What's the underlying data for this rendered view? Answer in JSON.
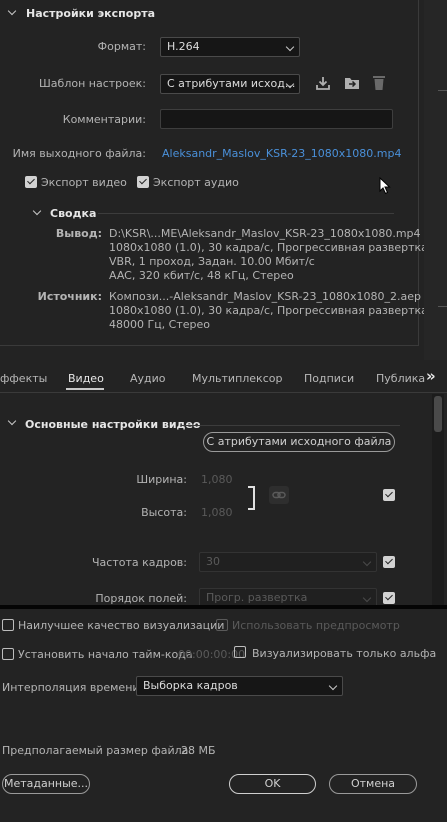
{
  "export_settings": {
    "title": "Настройки экспорта",
    "format_label": "Формат:",
    "format_value": "H.264",
    "preset_label": "Шаблон настроек:",
    "preset_value": "С атрибутами исход...",
    "comments_label": "Комментарии:",
    "comments_value": "",
    "output_name_label": "Имя выходного файла:",
    "output_name_value": "Aleksandr_Maslov_KSR-23_1080x1080.mp4",
    "export_video_label": "Экспорт видео",
    "export_video_checked": true,
    "export_audio_label": "Экспорт аудио",
    "export_audio_checked": true
  },
  "summary": {
    "title": "Сводка",
    "output_label": "Вывод:",
    "output_lines": [
      "D:\\KSR\\...ME\\Aleksandr_Maslov_KSR-23_1080x1080.mp4",
      "1080x1080 (1.0), 30 кадра/с, Прогрессивная развертка...",
      "VBR, 1 проход, Задан. 10.00 Мбит/с",
      "AAC, 320 кбит/с, 48 кГц, Стерео"
    ],
    "source_label": "Источник:",
    "source_lines": [
      "Компози...-Aleksandr_Maslov_KSR-23_1080x1080_2.aep",
      "1080x1080 (1.0), 30 кадра/с, Прогрессивная развертка...",
      "48000 Гц, Стерео"
    ]
  },
  "tabs": {
    "items": [
      "ффекты",
      "Видео",
      "Аудио",
      "Мультиплексор",
      "Подписи",
      "Публика"
    ],
    "active": "Видео",
    "more": "»"
  },
  "video": {
    "section_title": "Основные настройки видео",
    "match_source_button": "С атрибутами исходного файла",
    "width_label": "Ширина:",
    "width_value": "1,080",
    "height_label": "Высота:",
    "height_value": "1,080",
    "framerate_label": "Частота кадров:",
    "framerate_value": "30",
    "field_order_label": "Порядок полей:",
    "field_order_value": "Прогр. развертка"
  },
  "bottom": {
    "max_quality_label": "Наилучшее качество визуализации",
    "use_previews_label": "Использовать предпросмотр",
    "set_timecode_label": "Установить начало тайм-кода",
    "timecode_value": "00:00:00:00",
    "render_alpha_label": "Визуализировать только альфа",
    "time_interp_label": "Интерполяция времени:",
    "time_interp_value": "Выборка кадров",
    "est_size_label": "Предполагаемый размер файла:",
    "est_size_value": "28 МБ",
    "metadata_button": "Метаданные...",
    "ok_button": "OK",
    "cancel_button": "Отмена"
  },
  "colors": {
    "background": "#232323",
    "link": "#4a90d9",
    "checkbox": "#d2d2d2"
  }
}
